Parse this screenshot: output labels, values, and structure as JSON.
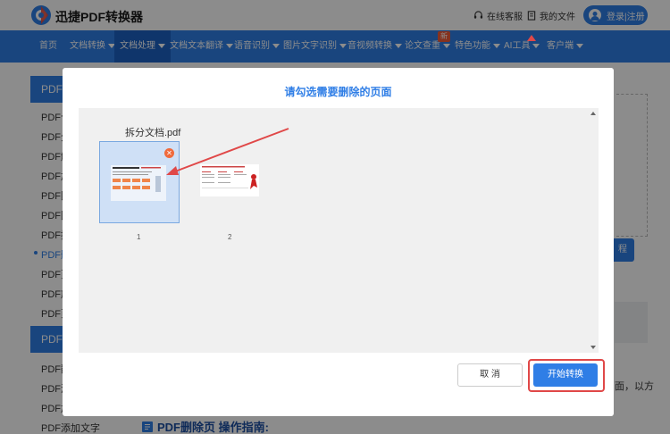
{
  "header": {
    "app_name": "迅捷PDF转换器",
    "links": [
      "在线客服",
      "我的文件"
    ],
    "login_label": "登录|注册"
  },
  "nav": {
    "items": [
      "首页",
      "文档转换",
      "文档处理",
      "文档文本翻译",
      "语音识别",
      "图片文字识别",
      "音视频转换",
      "论文查重",
      "特色功能",
      "AI工具",
      "客户端"
    ],
    "badge": "新",
    "active": "文档处理"
  },
  "sidebar": {
    "head1": "PDF分",
    "items1": [
      "PDF合",
      "PDF分",
      "PDF解",
      "PDF加",
      "PDF图",
      "PDF图",
      "PDF提",
      "PDF删",
      "PDF页",
      "PDF旋",
      "PDF页"
    ],
    "head2": "PDF",
    "items2": [
      "PDF翻",
      "PDF添",
      "PDF加",
      "PDF添加文字"
    ],
    "current_index": 7
  },
  "background": {
    "right_button": "程",
    "right_text": "面，以方",
    "guide_title": "PDF删除页 操作指南:"
  },
  "modal": {
    "title": "请勾选需要删除的页面",
    "file_name": "拆分文档.pdf",
    "pages": [
      {
        "number": "1",
        "selected": true
      },
      {
        "number": "2",
        "selected": false
      }
    ],
    "cancel_label": "取 消",
    "start_label": "开始转换"
  },
  "colors": {
    "brand": "#2f7ee6",
    "highlight": "#e04848",
    "delete_badge": "#f06a3c"
  }
}
